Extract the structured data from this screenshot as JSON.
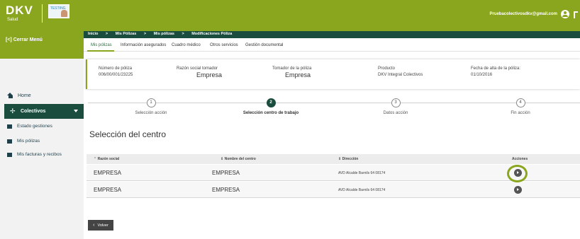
{
  "brand": {
    "logo_text": "DKV",
    "logo_sub": "Salud",
    "badge_text": "TESTING"
  },
  "header": {
    "user_email": "Pruebacolectivosdkv@gmail.com"
  },
  "sidebar": {
    "close_menu": "[<] Cerrar Menú",
    "home": "Home",
    "active_section": "Colectivos",
    "items": [
      {
        "label": "Estado gestiones"
      },
      {
        "label": "Mis pólizas"
      },
      {
        "label": "Mis facturas y recibos"
      }
    ]
  },
  "breadcrumb": [
    "Inicio",
    ">",
    "Mis Pólizas",
    ">",
    "Mis pólizas",
    ">",
    "Modificaciones Póliza"
  ],
  "tabs": [
    {
      "label": "Mis pólizas",
      "active": true
    },
    {
      "label": "Información asegurados"
    },
    {
      "label": "Cuadro médico"
    },
    {
      "label": "Otros servicios"
    },
    {
      "label": "Gestión documental"
    }
  ],
  "policy": {
    "number_label": "Número de póliza",
    "number_value": "006/00/001/23225",
    "company_label": "Razón social tomador",
    "company_value": "Empresa",
    "holder_label": "Tomador de la póliza",
    "holder_value": "Empresa",
    "product_label": "Producto",
    "product_value": "DKV Integral Colectivos",
    "date_label": "Fecha de alta de la póliza:",
    "date_value": "01/10/2016"
  },
  "steps": [
    {
      "number": "1",
      "label": "Selección acción"
    },
    {
      "number": "2",
      "label": "Selección centro de trabajo",
      "active": true
    },
    {
      "number": "3",
      "label": "Datos acción"
    },
    {
      "number": "4",
      "label": "Fin acción"
    }
  ],
  "section_title": "Selección del centro",
  "table": {
    "headers": [
      "⌃ Razón social",
      "⇕ Nombre del centro",
      "⇕ Dirección",
      "Acciones"
    ],
    "rows": [
      {
        "razon": "EMPRESA",
        "centro": "EMPRESA",
        "direccion": "AVD Alcalde Barnils 64 08174"
      },
      {
        "razon": "EMPRESA",
        "centro": "EMPRESA",
        "direccion": "AVD Alcalde Barnils 64 08174"
      }
    ]
  },
  "back_button": {
    "chevron": "‹",
    "label": "Volver"
  },
  "colors": {
    "brand_green": "#8aa61e",
    "dark_green": "#1b4d3e"
  }
}
